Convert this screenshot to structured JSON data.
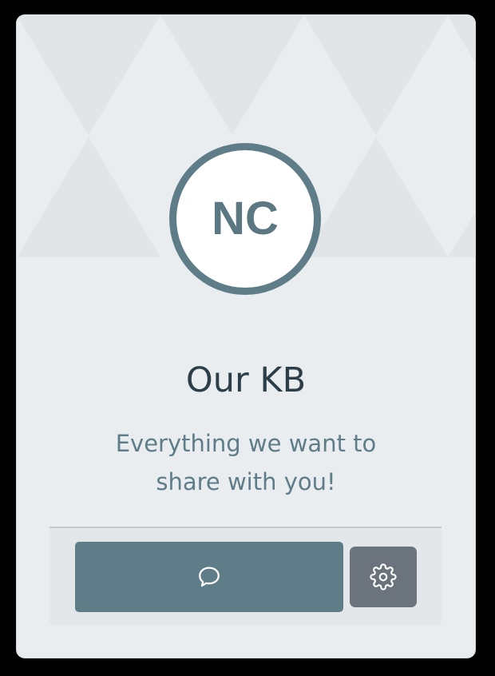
{
  "card": {
    "avatar_initials": "NC",
    "title": "Our KB",
    "subtitle_line1": "Everything we want to",
    "subtitle_line2": "share with you!"
  },
  "actions": {
    "chat_icon": "chat-bubble-icon",
    "settings_icon": "gear-icon"
  },
  "colors": {
    "accent": "#5f7d88",
    "settings_button": "#6b737c",
    "card_background": "#e9edf0",
    "title_text": "#2c3e48"
  }
}
